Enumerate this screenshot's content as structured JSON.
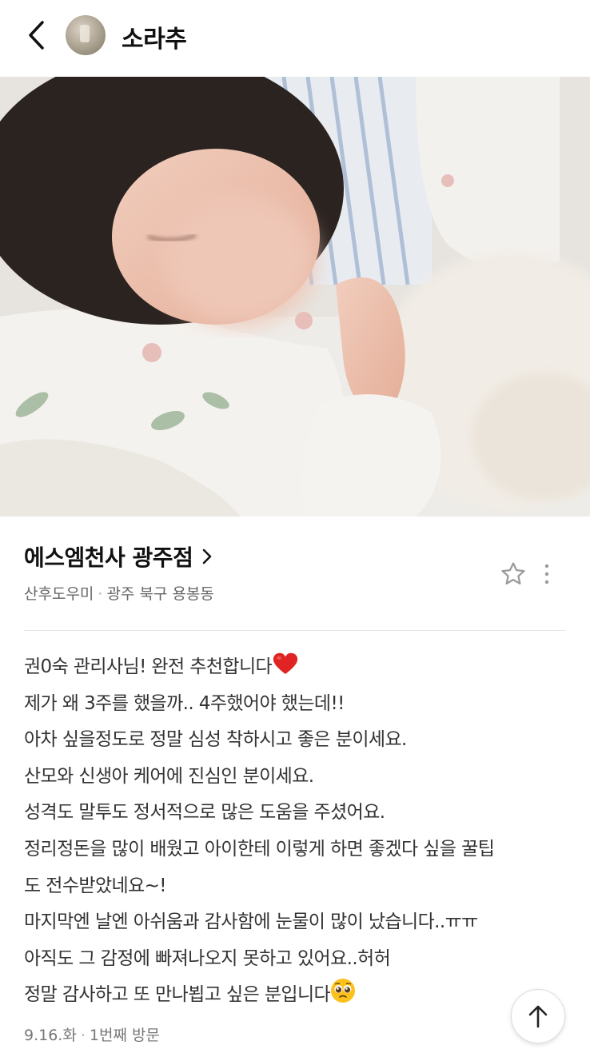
{
  "header": {
    "author_name": "소라추"
  },
  "place": {
    "name": "에스엠천사 광주점",
    "category": "산후도우미",
    "location": "광주 북구 용봉동"
  },
  "review": {
    "lines": [
      "권0숙 관리사님! 완전 추천합니다",
      "제가 왜 3주를 했을까.. 4주했어야 했는데!!",
      "아차 싶을정도로 정말 심성 착하시고 좋은 분이세요.",
      "산모와 신생아 케어에 진심인 분이세요.",
      "성격도 말투도 정서적으로 많은 도움을 주셨어요.",
      "정리정돈을 많이 배웠고 아이한테 이렇게 하면 좋겠다 싶을 꿀팁",
      "도 전수받았네요~!",
      "마지막엔 날엔 아쉬움과 감사함에 눈물이 많이 났습니다..ㅠㅠ",
      "아직도 그 감정에 빠져나오지 못하고 있어요..허허",
      "정말 감사하고 또 만나뵙고 싶은 분입니다"
    ]
  },
  "visit": {
    "date": "9.16.화",
    "count": "1번째 방문"
  },
  "icons": {
    "back": "chevron-left-icon",
    "star": "star-outline-icon",
    "more": "more-vertical-icon",
    "heart": "red-heart-icon",
    "emoji": "pleading-face-icon",
    "top": "arrow-up-icon"
  }
}
